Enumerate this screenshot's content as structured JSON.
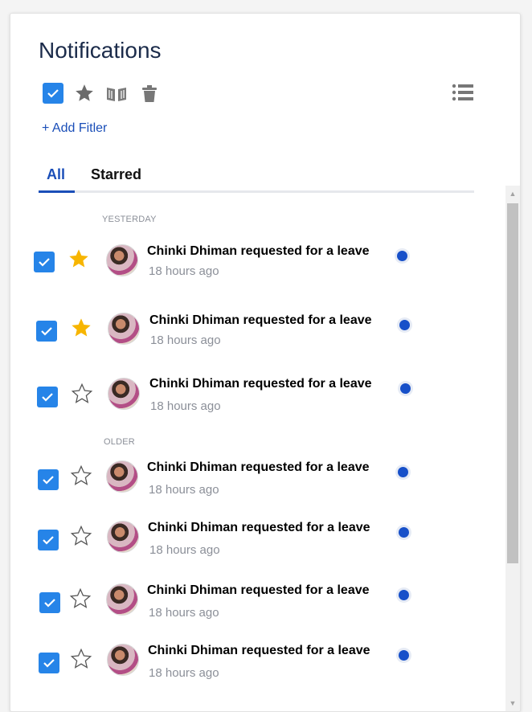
{
  "header": {
    "title": "Notifications"
  },
  "toolbar": {
    "select_all_icon": "checkbox-checked-icon",
    "star_icon": "star-icon",
    "read_icon": "open-book-icon",
    "delete_icon": "trash-icon",
    "view_icon": "list-view-icon"
  },
  "filter": {
    "add_label": "+ Add Fitler"
  },
  "tabs": [
    {
      "label": "All",
      "active": true
    },
    {
      "label": "Starred",
      "active": false
    }
  ],
  "sections": [
    {
      "label": "YESTERDAY"
    },
    {
      "label": "OLDER"
    }
  ],
  "notifications": [
    {
      "title": "Chinki Dhiman requested for a leave",
      "time": "18 hours ago",
      "starred": true,
      "checked": true,
      "unread": true,
      "section": "YESTERDAY"
    },
    {
      "title": "Chinki Dhiman requested for a leave",
      "time": "18 hours ago",
      "starred": true,
      "checked": true,
      "unread": true,
      "section": "YESTERDAY"
    },
    {
      "title": "Chinki Dhiman requested for a leave",
      "time": "18 hours ago",
      "starred": false,
      "checked": true,
      "unread": true,
      "section": "YESTERDAY"
    },
    {
      "title": "Chinki Dhiman requested for a leave",
      "time": "18 hours ago",
      "starred": false,
      "checked": true,
      "unread": true,
      "section": "OLDER"
    },
    {
      "title": "Chinki Dhiman requested for a leave",
      "time": "18 hours ago",
      "starred": false,
      "checked": true,
      "unread": true,
      "section": "OLDER"
    },
    {
      "title": "Chinki Dhiman requested for a leave",
      "time": "18 hours ago",
      "starred": false,
      "checked": true,
      "unread": true,
      "section": "OLDER"
    },
    {
      "title": "Chinki Dhiman requested for a leave",
      "time": "18 hours ago",
      "starred": false,
      "checked": true,
      "unread": true,
      "section": "OLDER"
    }
  ],
  "colors": {
    "accent": "#1a4eb8",
    "checkbox": "#2684e8",
    "star_filled": "#f7b500",
    "unread_dot": "#1750c9"
  }
}
